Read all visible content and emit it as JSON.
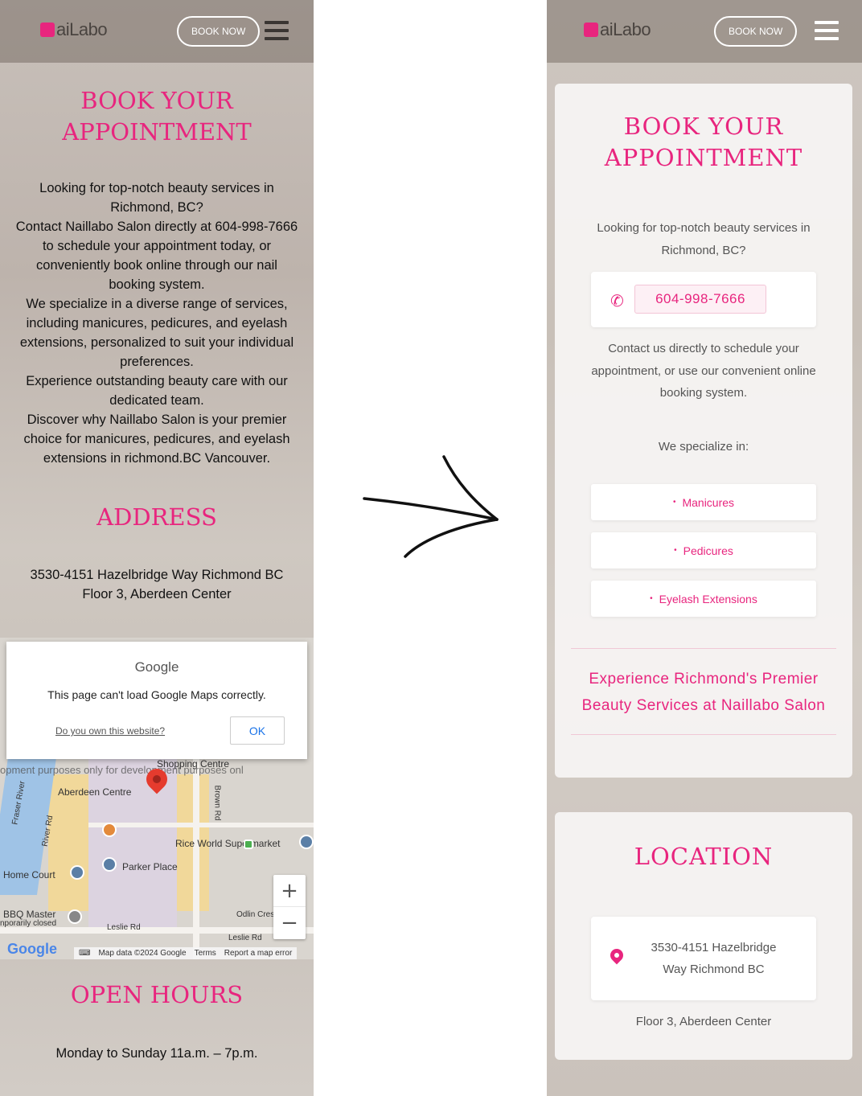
{
  "brand": {
    "logo_prefix": "N",
    "logo_main": "ai",
    "logo_suffix": "Labo"
  },
  "header": {
    "book_label": "BOOK NOW"
  },
  "before": {
    "title_line1": "BOOK YOUR",
    "title_line2": "APPOINTMENT",
    "intro_lines": [
      "Looking for top-notch beauty services in",
      "Richmond, BC?",
      "Contact Naillabo Salon directly at 604-998-7666",
      "to schedule your appointment today, or",
      "conveniently book online through our nail",
      "booking system.",
      "We specialize in a diverse range of services,",
      "including manicures, pedicures, and eyelash",
      "extensions, personalized to suit your individual",
      "preferences.",
      "Experience outstanding beauty care with our",
      "dedicated team.",
      "Discover why Naillabo Salon is your premier",
      "choice for manicures, pedicures, and eyelash",
      "extensions in richmond.BC Vancouver."
    ],
    "address_title": "ADDRESS",
    "address_line1": "3530-4151 Hazelbridge Way Richmond BC",
    "address_line2": "Floor 3, Aberdeen Center",
    "map": {
      "dialog_brand": "Google",
      "dialog_message": "This page can't load Google Maps correctly.",
      "dialog_link": "Do you own this website?",
      "dialog_ok": "OK",
      "dev_watermark": "opment purposes only    for development purposes onl",
      "labels": [
        "Aberdeen Centre",
        "Shopping Centre",
        "Rice World Supermarket",
        "Parker Place",
        "Home Court",
        "BBQ Master",
        "nporarily closed",
        "Odlin Crescent",
        "Leslie Rd",
        "Leslie Rd",
        "Brown Rd",
        "River Rd",
        "Fraser River"
      ],
      "zoom_in": "+",
      "zoom_out": "−",
      "google_logo": "Google",
      "footer": [
        "Map data ©2024 Google",
        "Terms",
        "Report a map error"
      ]
    },
    "hours_title": "OPEN HOURS",
    "hours_text": "Monday to Sunday 11a.m. – 7p.m."
  },
  "after": {
    "title_line1": "BOOK YOUR",
    "title_line2": "APPOINTMENT",
    "intro_line1": "Looking for top-notch beauty services in",
    "intro_line2": "Richmond, BC?",
    "phone": "604-998-7666",
    "contact_line1": "Contact us directly to schedule your",
    "contact_line2": "appointment, or use our convenient online",
    "contact_line3": "booking system.",
    "specialize_label": "We specialize in:",
    "services": [
      "Manicures",
      "Pedicures",
      "Eyelash Extensions"
    ],
    "tagline_line1": "Experience Richmond's Premier",
    "tagline_line2": "Beauty Services at Naillabo Salon",
    "location_title": "LOCATION",
    "location_line1": "3530-4151 Hazelbridge",
    "location_line2": "Way Richmond BC",
    "location_floor": "Floor 3, Aberdeen Center"
  },
  "colors": {
    "accent": "#e8257e",
    "header_overlay": "#786e66"
  },
  "icons": {
    "menu": "hamburger-icon",
    "phone": "phone-icon",
    "location": "map-pin-icon",
    "arrow": "hand-drawn-arrow"
  }
}
